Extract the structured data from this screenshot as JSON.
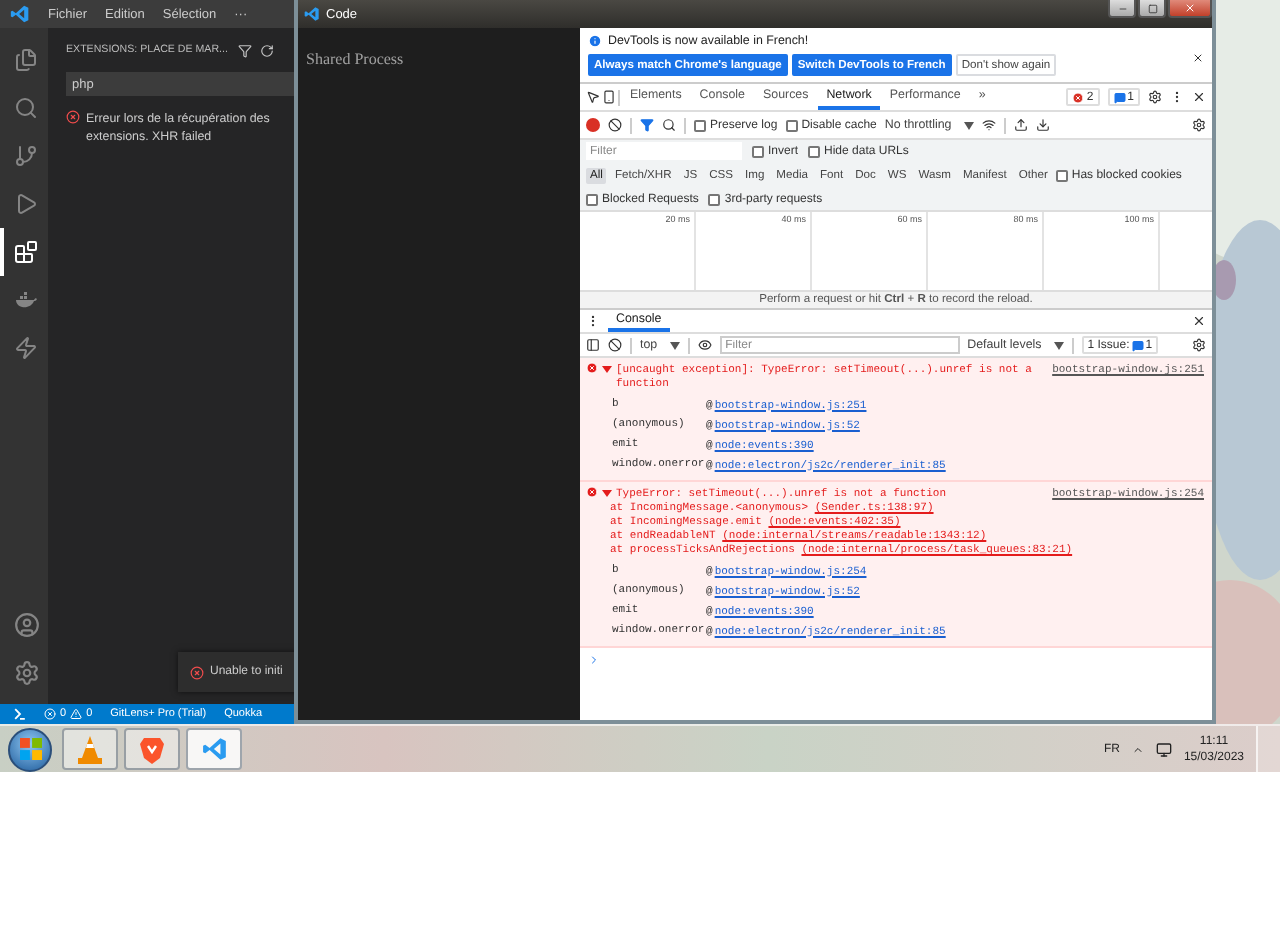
{
  "vscode": {
    "menu": [
      "Fichier",
      "Edition",
      "Sélection",
      "···"
    ],
    "activity_bar": [
      {
        "selected": false
      },
      {
        "selected": false
      },
      {
        "selected": false
      },
      {
        "selected": false
      },
      {
        "selected": true
      },
      {
        "selected": false
      },
      {
        "selected": false
      }
    ],
    "sidebar": {
      "title": "EXTENSIONS: PLACE DE MAR...",
      "search": {
        "value": "php"
      },
      "error": "Erreur lors de la récupération des extensions. XHR failed"
    },
    "notification": {
      "text": "Unable to initi"
    },
    "status_bar": {
      "errors": "0",
      "warnings": "0",
      "items": [
        "GitLens+ Pro (Trial)",
        "Quokka"
      ]
    }
  },
  "code_window": {
    "title": "Code",
    "page_text": "Shared Process"
  },
  "devtools": {
    "infobar": {
      "message": "DevTools is now available in French!",
      "buttons": [
        {
          "label": "Always match Chrome's language",
          "kind": "primary"
        },
        {
          "label": "Switch DevTools to French",
          "kind": "primary"
        },
        {
          "label": "Don't show again",
          "kind": "secondary"
        }
      ]
    },
    "tabs": [
      {
        "label": "Elements",
        "selected": false
      },
      {
        "label": "Console",
        "selected": false
      },
      {
        "label": "Sources",
        "selected": false
      },
      {
        "label": "Network",
        "selected": true
      },
      {
        "label": "Performance",
        "selected": false
      }
    ],
    "more_tabs": "»",
    "error_count": "2",
    "message_count": "1",
    "network_toolbar": {
      "recording": true,
      "filter_active": true,
      "options": [
        {
          "label": "Preserve log",
          "checked": false
        },
        {
          "label": "Disable cache",
          "checked": false
        }
      ],
      "throttling": "No throttling"
    },
    "filter": {
      "placeholder": "Filter",
      "options": [
        {
          "label": "Invert",
          "checked": false
        },
        {
          "label": "Hide data URLs",
          "checked": false
        }
      ]
    },
    "types": [
      {
        "label": "All",
        "selected": true
      },
      {
        "label": "Fetch/XHR",
        "selected": false
      },
      {
        "label": "JS",
        "selected": false
      },
      {
        "label": "CSS",
        "selected": false
      },
      {
        "label": "Img",
        "selected": false
      },
      {
        "label": "Media",
        "selected": false
      },
      {
        "label": "Font",
        "selected": false
      },
      {
        "label": "Doc",
        "selected": false
      },
      {
        "label": "WS",
        "selected": false
      },
      {
        "label": "Wasm",
        "selected": false
      },
      {
        "label": "Manifest",
        "selected": false
      },
      {
        "label": "Other",
        "selected": false
      }
    ],
    "type_options": [
      {
        "label": "Has blocked cookies",
        "checked": false
      }
    ],
    "request_options": [
      {
        "label": "Blocked Requests",
        "checked": false
      },
      {
        "label": "3rd-party requests",
        "checked": false
      }
    ],
    "timeline_ticks": [
      "20 ms",
      "40 ms",
      "60 ms",
      "80 ms",
      "100 ms"
    ],
    "hint": "Perform a request or hit **Ctrl** + **R** to record the reload.",
    "drawer": {
      "tabs": [
        {
          "label": "Console",
          "selected": true
        }
      ],
      "context": "top",
      "filter_placeholder": "Filter",
      "levels": "Default levels",
      "issues": {
        "label": "1 Issue:",
        "count": "1"
      }
    },
    "messages": [
      {
        "expanded": true,
        "text": "[uncaught exception]: TypeError: setTimeout(...).unref is not a function",
        "source": "bootstrap-window.js:251",
        "stack": [
          {
            "function": "b",
            "at": "@",
            "link": "bootstrap-window.js:251"
          },
          {
            "function": "(anonymous)",
            "at": "@",
            "link": "bootstrap-window.js:52"
          },
          {
            "function": "emit",
            "at": "@",
            "link": "node:events:390"
          },
          {
            "function": "window.onerror",
            "at": "@",
            "link": "node:electron/js2c/renderer_init:85"
          }
        ]
      },
      {
        "expanded": true,
        "text": "TypeError: setTimeout(...).unref is not a function",
        "source": "bootstrap-window.js:254",
        "trace": [
          {
            "call": "at IncomingMessage.<anonymous>",
            "location": "(Sender.ts:138:97)"
          },
          {
            "call": "at IncomingMessage.emit",
            "location": "(node:events:402:35)"
          },
          {
            "call": "at endReadableNT",
            "location": "(node:internal/streams/readable:1343:12)"
          },
          {
            "call": "at processTicksAndRejections",
            "location": "(node:internal/process/task_queues:83:21)"
          }
        ],
        "stack": [
          {
            "function": "b",
            "at": "@",
            "link": "bootstrap-window.js:254"
          },
          {
            "function": "(anonymous)",
            "at": "@",
            "link": "bootstrap-window.js:52"
          },
          {
            "function": "emit",
            "at": "@",
            "link": "node:events:390"
          },
          {
            "function": "window.onerror",
            "at": "@",
            "link": "node:electron/js2c/renderer_init:85"
          }
        ]
      }
    ]
  },
  "taskbar": {
    "apps": [
      {
        "selected": false
      },
      {
        "selected": false
      },
      {
        "selected": true
      }
    ],
    "language": "FR",
    "time": "11:11",
    "date": "15/03/2023"
  }
}
